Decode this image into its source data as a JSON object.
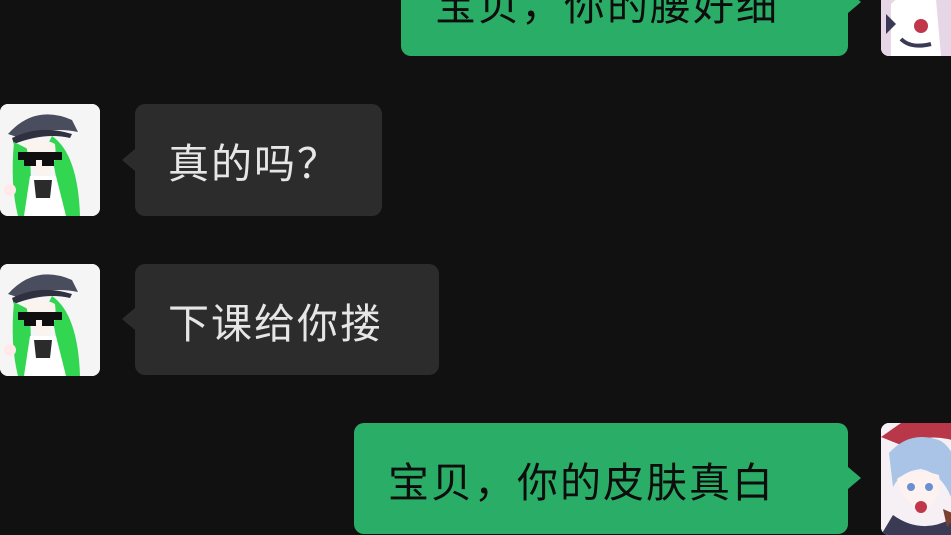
{
  "conversation": {
    "messages": [
      {
        "sender": "self",
        "text": "宝贝，你的腰好细",
        "avatar_icon": "pink-haired-anime-avatar-icon"
      },
      {
        "sender": "other",
        "text": "真的吗？",
        "avatar_icon": "green-haired-anime-sunglasses-avatar-icon"
      },
      {
        "sender": "other",
        "text": "下课给你搂",
        "avatar_icon": "green-haired-anime-sunglasses-avatar-icon"
      },
      {
        "sender": "self",
        "text": "宝贝，你的皮肤真白",
        "avatar_icon": "pink-haired-anime-avatar-icon"
      }
    ]
  },
  "colors": {
    "background": "#111111",
    "incoming_bubble": "#2c2c2c",
    "outgoing_bubble": "#2aae67",
    "incoming_text": "#e6e6e6",
    "outgoing_text": "#0d0d0d"
  }
}
